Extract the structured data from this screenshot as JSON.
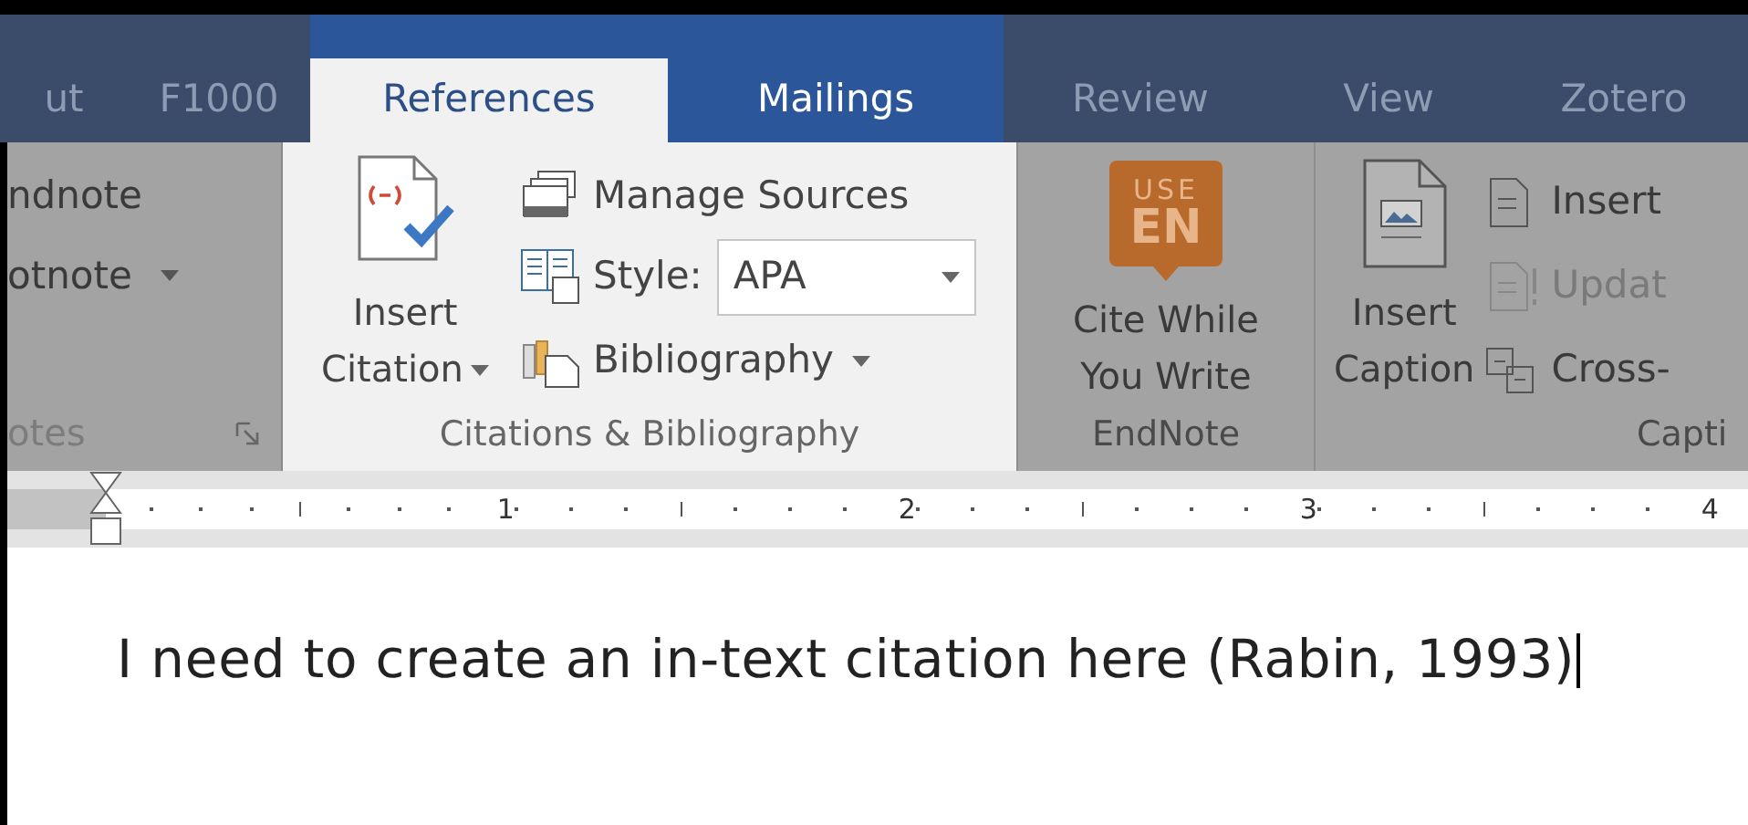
{
  "tabs": [
    {
      "label": "ut",
      "selected": false,
      "dimmed": true
    },
    {
      "label": "F1000",
      "selected": false,
      "dimmed": true
    },
    {
      "label": "References",
      "selected": true,
      "dimmed": false
    },
    {
      "label": "Mailings",
      "selected": false,
      "dimmed": false
    },
    {
      "label": "Review",
      "selected": false,
      "dimmed": true
    },
    {
      "label": "View",
      "selected": false,
      "dimmed": true
    },
    {
      "label": "Zotero",
      "selected": false,
      "dimmed": true
    }
  ],
  "ribbon_groups": [
    {
      "label": "otes",
      "dimmed": true,
      "label_disabled": true,
      "items": [
        {
          "label": "ndnote",
          "dropdown": false
        },
        {
          "label": "otnote",
          "dropdown": true
        }
      ]
    },
    {
      "label": "Citations & Bibliography",
      "dimmed": false,
      "label_disabled": false,
      "insert_citation": {
        "lines": [
          "Insert",
          "Citation"
        ],
        "dropdown": true
      },
      "manage_sources": "Manage Sources",
      "style": {
        "label": "Style:",
        "value": "APA"
      },
      "bibliography": {
        "label": "Bibliography",
        "dropdown": true
      }
    },
    {
      "label": "EndNote",
      "dimmed": true,
      "label_disabled": false,
      "badge": [
        "USE",
        "EN"
      ],
      "button_lines": [
        "Cite While",
        "You Write"
      ]
    },
    {
      "label": "Capti",
      "dimmed": true,
      "label_disabled": false,
      "insert_caption": [
        "Insert",
        "Caption"
      ],
      "items": [
        {
          "label": "Insert",
          "disabled": false
        },
        {
          "label": "Updat",
          "disabled": true
        },
        {
          "label": "Cross-",
          "disabled": false
        }
      ]
    }
  ],
  "ruler": {
    "numbers": [
      "1",
      "2",
      "3",
      "4"
    ]
  },
  "document": {
    "text": "I need to create an in-text citation here (Rabin, 1993)"
  }
}
